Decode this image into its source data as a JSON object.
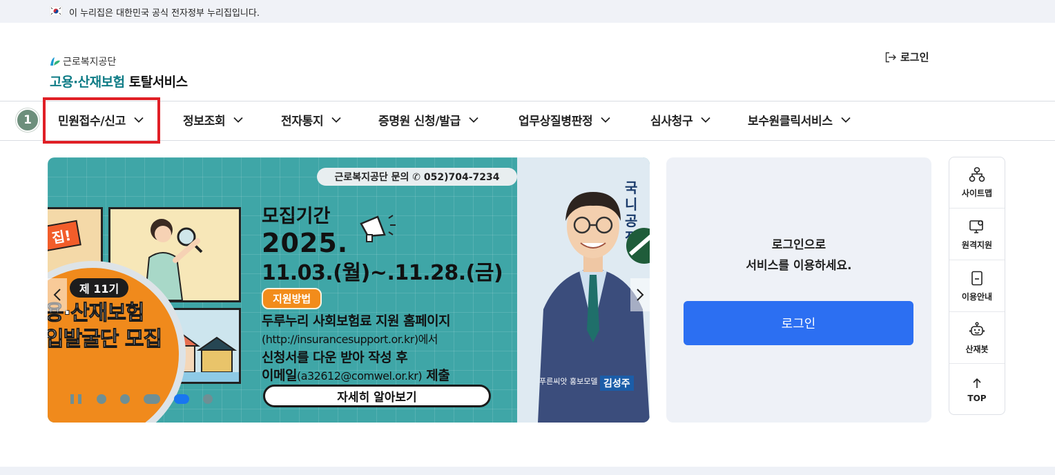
{
  "gov_banner": {
    "text": "이 누리집은 대한민국 공식 전자정부 누리집입니다."
  },
  "header": {
    "org_name": "근로복지공단",
    "service_name_accent": "고용·산재보험",
    "service_name_rest": "토탈서비스",
    "login_link": "로그인"
  },
  "step_badge": "1",
  "nav": {
    "items": [
      {
        "label": "민원접수/신고"
      },
      {
        "label": "정보조회"
      },
      {
        "label": "전자통지"
      },
      {
        "label": "증명원 신청/발급"
      },
      {
        "label": "업무상질병판정"
      },
      {
        "label": "심사청구"
      },
      {
        "label": "보수원클릭서비스"
      }
    ]
  },
  "banner": {
    "contact": "근로복지공단 문의 ✆ 052)704-7234",
    "corner_tag": "집!",
    "gen_label": "제 11기",
    "badge_line1": "용·산재보험",
    "badge_line2": "입발굴단 모집",
    "recruit_title": "모집기간",
    "recruit_year": "2025.",
    "recruit_range": "11.03.(월)~.11.28.(금)",
    "method_tag": "지원방법",
    "method_line1": "두루누리 사회보험료 지원 홈페이지",
    "method_line2_light": "(http://insurancesupport.or.kr)",
    "method_line2_end": "에서",
    "method_line3": "신청서를 다운 받아 작성 후",
    "method_line4_a": "이메일",
    "method_line4_light": "(a32612@comwel.or.kr)",
    "method_line4_b": " 제출",
    "more_button": "자세히 알아보기",
    "person_caption": "푸른씨앗 홍보모델",
    "person_name": "김성주",
    "side_headline_1": "국니",
    "side_headline_2": "공적"
  },
  "login_panel": {
    "message_line1": "로그인으로",
    "message_line2": "서비스를 이용하세요.",
    "button": "로그인"
  },
  "quick_menu": {
    "items": [
      {
        "label": "사이트맵",
        "icon": "sitemap-icon"
      },
      {
        "label": "원격지원",
        "icon": "remote-support-icon"
      },
      {
        "label": "이용안내",
        "icon": "guide-icon"
      },
      {
        "label": "산재봇",
        "icon": "chatbot-icon"
      },
      {
        "label": "TOP",
        "icon": "arrow-up-icon"
      }
    ]
  },
  "colors": {
    "accent_teal": "#0f7c86",
    "login_button": "#2c6ff2",
    "highlight_red": "#e01f26",
    "banner_bg": "#3fa6a7"
  }
}
